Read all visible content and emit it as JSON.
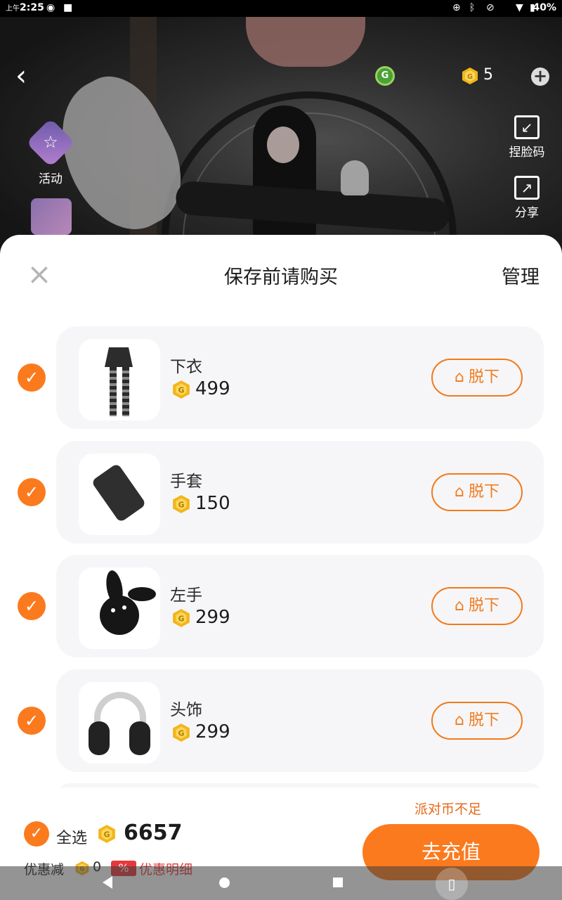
{
  "status_bar": {
    "ampm": "上午",
    "time": "2:25",
    "battery": "40%"
  },
  "top_bar": {
    "coin_count": "5",
    "actions": {
      "face_code": "捏脸码",
      "share": "分享",
      "activity": "活动"
    }
  },
  "sheet": {
    "title": "保存前请购买",
    "manage": "管理",
    "remove_label": "脱下",
    "items": [
      {
        "name": "下衣",
        "price": "499",
        "checked": true
      },
      {
        "name": "手套",
        "price": "150",
        "checked": true
      },
      {
        "name": "左手",
        "price": "299",
        "checked": true
      },
      {
        "name": "头饰",
        "price": "299",
        "checked": true
      }
    ]
  },
  "footer": {
    "insufficient": "派对币不足",
    "select_all": "全选",
    "total": "6657",
    "discount_label": "优惠减",
    "discount_value": "0",
    "discount_badge": "%",
    "discount_detail": "优惠明细",
    "recharge": "去充值"
  },
  "colors": {
    "accent": "#fb7a1e",
    "coin": "#f3b51c",
    "discount": "#e4393c"
  }
}
